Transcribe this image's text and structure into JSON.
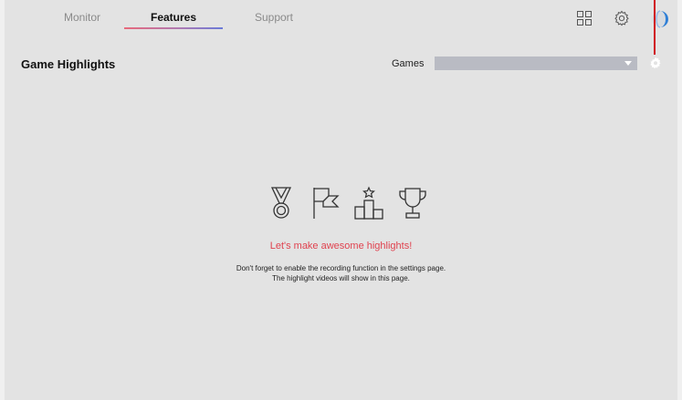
{
  "nav": {
    "tabs": [
      {
        "label": "Monitor",
        "active": false
      },
      {
        "label": "Features",
        "active": true
      },
      {
        "label": "Support",
        "active": false
      }
    ],
    "icons": [
      "grid-icon",
      "gear-icon",
      "avatar-icon"
    ]
  },
  "header": {
    "title": "Game Highlights",
    "games_label": "Games",
    "games_selected": ""
  },
  "empty_state": {
    "icons": [
      "medal-icon",
      "flag-icon",
      "podium-icon",
      "trophy-icon"
    ],
    "title": "Let's make awesome highlights!",
    "line1": "Don't forget to enable the recording function in the settings page.",
    "line2": "The highlight videos will show in this page."
  },
  "colors": {
    "background": "#e3e3e3",
    "accent_red": "#e0424f",
    "indicator_red": "#d0101e",
    "select_bg": "#b9bbc3"
  }
}
